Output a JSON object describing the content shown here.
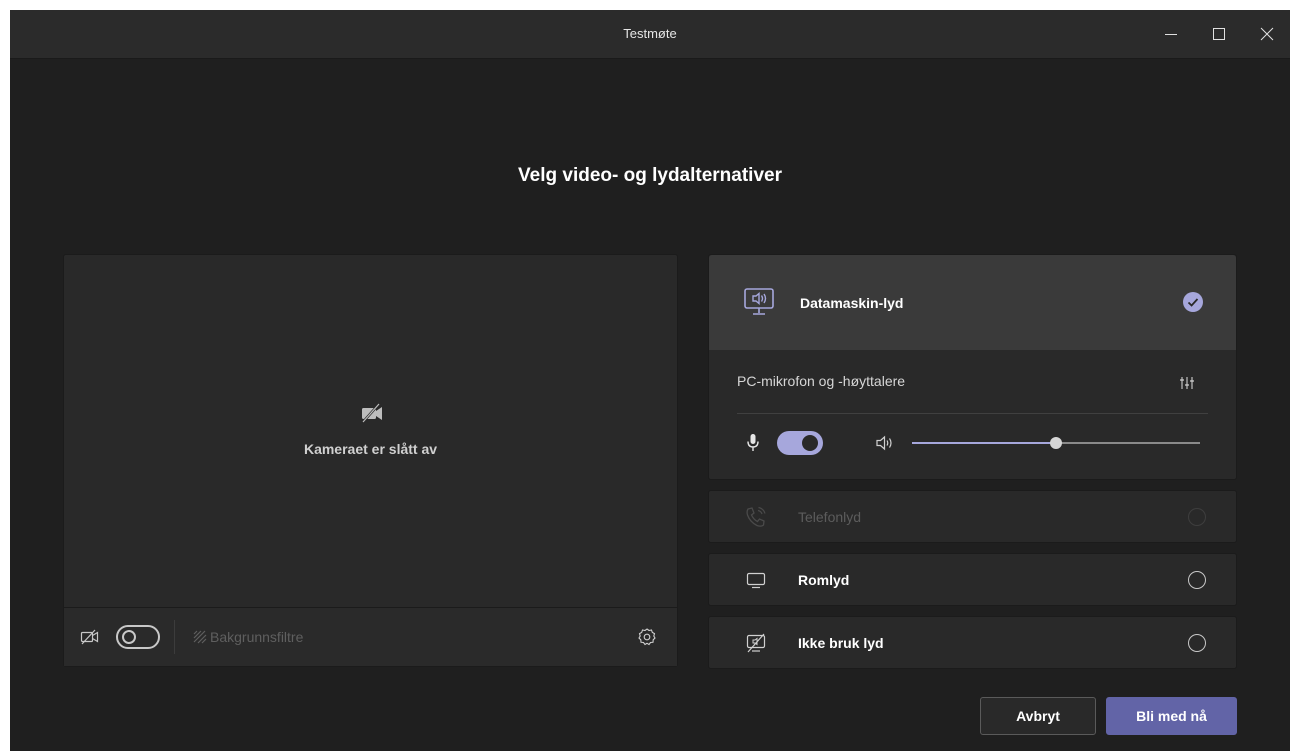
{
  "window": {
    "title": "Testmøte"
  },
  "heading": "Velg video- og lydalternativer",
  "preview": {
    "camera_off_text": "Kameraet er slått av",
    "background_filters_label": "Bakgrunnsfiltre",
    "camera_toggle_on": false
  },
  "audio": {
    "computer": {
      "label": "Datamaskin-lyd",
      "selected": true,
      "device_label": "PC-mikrofon og -høyttalere",
      "mic_toggle_on": true,
      "speaker_volume": 0.5
    },
    "phone": {
      "label": "Telefonlyd",
      "disabled": true
    },
    "room": {
      "label": "Romlyd"
    },
    "none": {
      "label": "Ikke bruk lyd"
    }
  },
  "buttons": {
    "cancel": "Avbryt",
    "join": "Bli med nå"
  },
  "colors": {
    "accent": "#6264a7",
    "accent_light": "#a6a7dc",
    "background": "#1f1f1f"
  }
}
